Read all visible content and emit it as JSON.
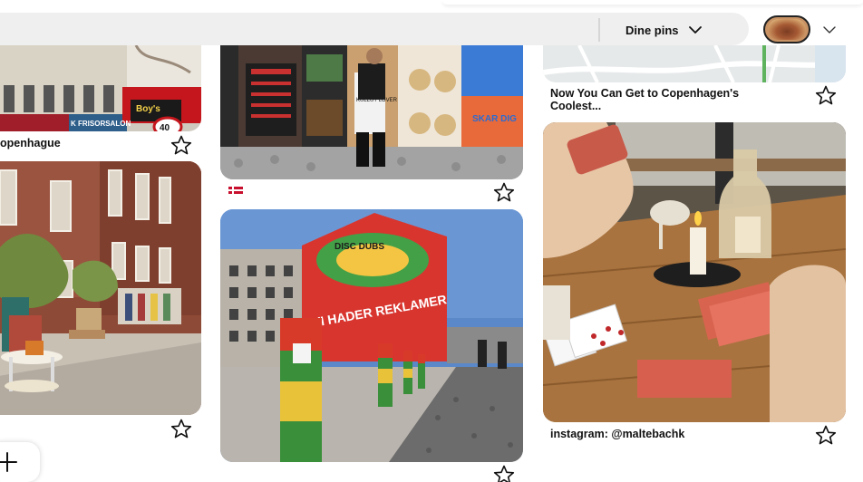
{
  "header": {
    "pins_dropdown_label": "Dine pins"
  },
  "pins": [
    {
      "title": "openhague",
      "saved": false
    },
    {
      "title": "",
      "saved": false,
      "flag": "denmark"
    },
    {
      "title": "Now You Can Get to Copenhagen's Coolest...",
      "saved": false
    },
    {
      "title": "",
      "saved": false
    },
    {
      "title": "",
      "saved": false
    },
    {
      "title": "instagram: @maltebachk",
      "saved": false
    }
  ],
  "images": {
    "street_pin": {
      "shop_sign": "Boy's",
      "shop_sign_sub": "SHAWARMA",
      "store_sign": "K FRISORSALON",
      "speed_sign": "40"
    },
    "poster_pin": {
      "tote_text": "KULLUT LOVER",
      "poster_text": "SKAR DIG"
    },
    "mural_pin": {
      "mural_text_top": "DISC DUBS",
      "mural_text_main": "VI HADER REKLAMER"
    }
  },
  "colors": {
    "accent": "#111111",
    "search_bg": "#efefef",
    "denmark_red": "#c8102e"
  }
}
